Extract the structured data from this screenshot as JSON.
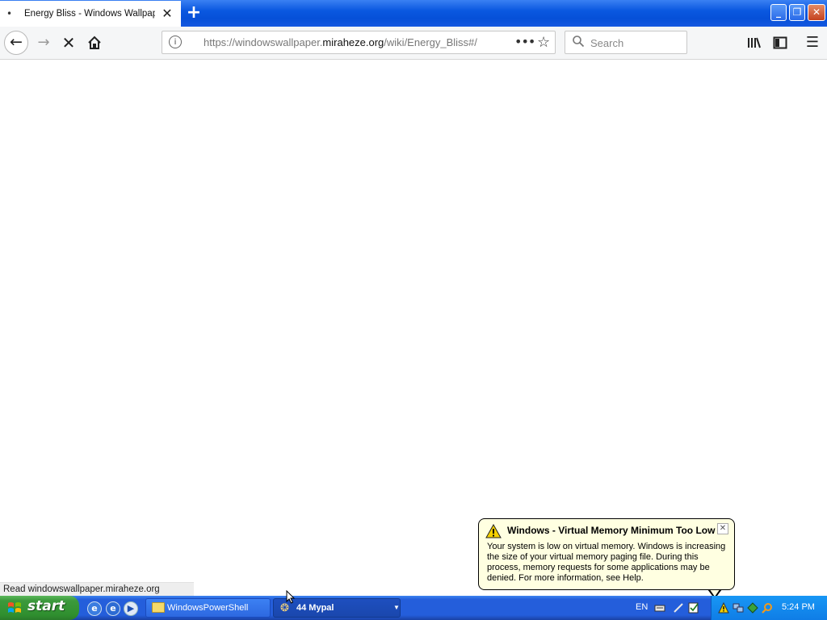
{
  "browser": {
    "tab_title": "Energy Bliss - Windows Wallpaper",
    "tab_dot": "•",
    "new_tab_symbol": "+",
    "url_prefix": "https://windowswallpaper.",
    "url_domain": "miraheze.org",
    "url_path": "/wiki/Energy_Bliss#/",
    "search_placeholder": "Search",
    "status_text": "Read windowswallpaper.miraheze.org",
    "loading": true
  },
  "balloon": {
    "title": "Windows - Virtual Memory Minimum Too Low",
    "message": "Your system is low on virtual memory. Windows is increasing the size of your virtual memory paging file. During this process, memory requests for some applications may be denied. For more information, see Help."
  },
  "taskbar": {
    "start_label": "start",
    "tasks": [
      {
        "label": "WindowsPowerShell",
        "active": false
      },
      {
        "label": "44 Mypal",
        "active": true
      }
    ],
    "language": "EN",
    "clock": "5:24 PM"
  },
  "colors": {
    "taskbar": "#245edb",
    "start_green": "#3c9a3c",
    "balloon_bg": "#ffffe1",
    "warning_yellow": "#f5d000"
  }
}
